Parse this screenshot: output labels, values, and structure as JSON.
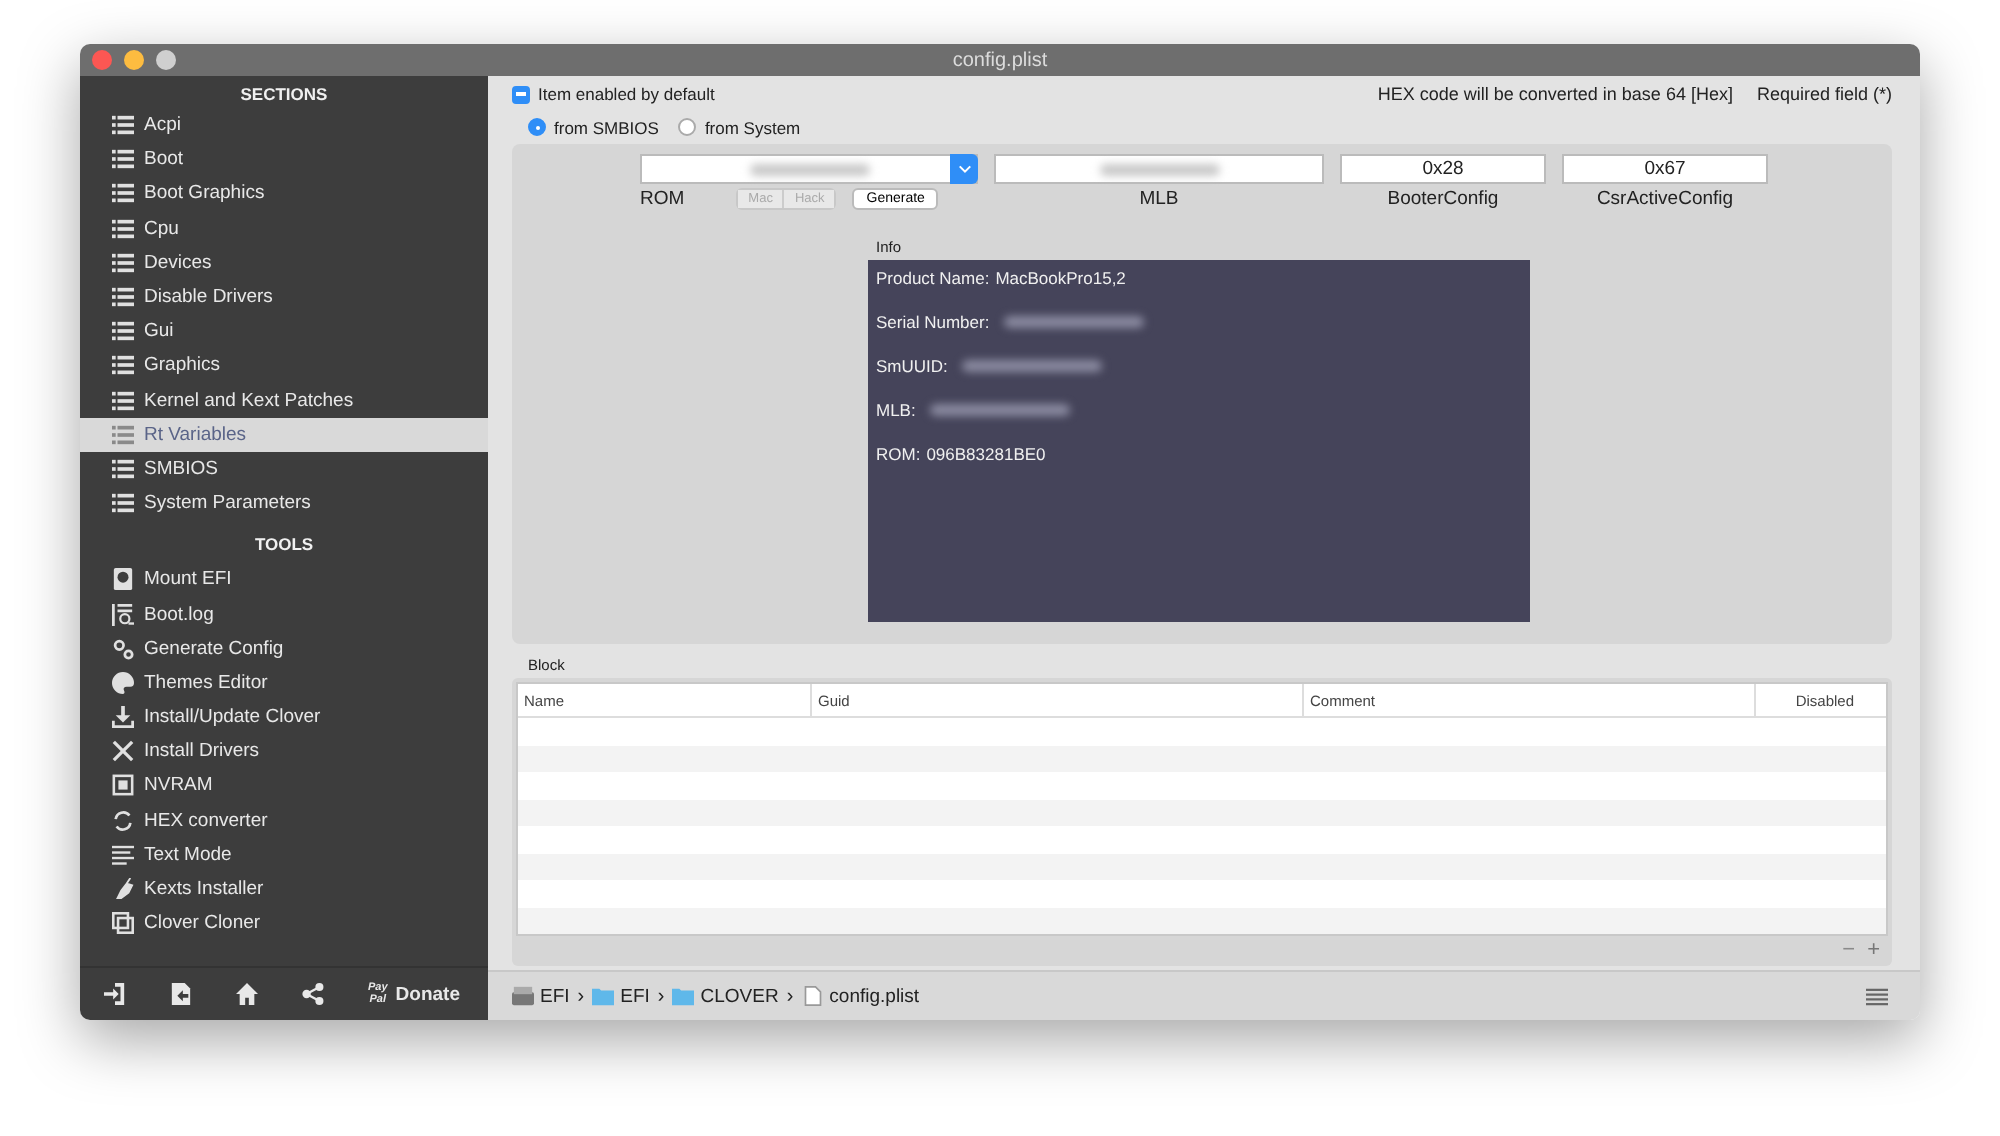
{
  "window": {
    "title": "config.plist"
  },
  "sidebar": {
    "sections_heading": "SECTIONS",
    "sections": [
      {
        "label": "Acpi",
        "selected": false
      },
      {
        "label": "Boot",
        "selected": false
      },
      {
        "label": "Boot Graphics",
        "selected": false
      },
      {
        "label": "Cpu",
        "selected": false
      },
      {
        "label": "Devices",
        "selected": false
      },
      {
        "label": "Disable Drivers",
        "selected": false
      },
      {
        "label": "Gui",
        "selected": false
      },
      {
        "label": "Graphics",
        "selected": false
      },
      {
        "label": "Kernel and Kext Patches",
        "selected": false
      },
      {
        "label": "Rt Variables",
        "selected": true
      },
      {
        "label": "SMBIOS",
        "selected": false
      },
      {
        "label": "System Parameters",
        "selected": false
      }
    ],
    "tools_heading": "TOOLS",
    "tools": [
      {
        "label": "Mount EFI"
      },
      {
        "label": "Boot.log"
      },
      {
        "label": "Generate Config"
      },
      {
        "label": "Themes Editor"
      },
      {
        "label": "Install/Update Clover"
      },
      {
        "label": "Install Drivers"
      },
      {
        "label": "NVRAM"
      },
      {
        "label": "HEX converter"
      },
      {
        "label": "Text Mode"
      },
      {
        "label": "Kexts Installer"
      },
      {
        "label": "Clover Cloner"
      }
    ],
    "donate": {
      "paypal_top": "Pay",
      "paypal_bottom": "Pal",
      "label": "Donate"
    }
  },
  "main": {
    "enabled_checkbox": {
      "label": "Item enabled by default",
      "checked": true
    },
    "hex_note": "HEX code will be converted in base 64 [Hex]",
    "required_note": "Required field (*)",
    "source_radios": [
      {
        "label": "from SMBIOS",
        "selected": true
      },
      {
        "label": "from System",
        "selected": false
      }
    ],
    "rom": {
      "label": "ROM",
      "redacted": true
    },
    "mac_hack": [
      {
        "label": "Mac",
        "disabled": true
      },
      {
        "label": "Hack",
        "disabled": true
      }
    ],
    "generate": "Generate",
    "mlb": {
      "label": "MLB",
      "redacted": true
    },
    "booter_config": {
      "label": "BooterConfig",
      "value": "0x28"
    },
    "csr_active_config": {
      "label": "CsrActiveConfig",
      "value": "0x67"
    },
    "info": {
      "label": "Info",
      "lines": [
        {
          "label": "Product Name:",
          "value": "MacBookPro15,2"
        },
        {
          "label": "Serial Number:"
        },
        {
          "label": "SmUUID:"
        },
        {
          "label": "MLB:"
        },
        {
          "label": "ROM:",
          "value": "096B83281BE0"
        }
      ]
    },
    "block": {
      "label": "Block",
      "columns": [
        "Name",
        "Guid",
        "Comment",
        "Disabled"
      ],
      "remove": "−",
      "add": "+"
    },
    "breadcrumb": [
      {
        "kind": "disk",
        "label": "EFI",
        "separator": "›"
      },
      {
        "kind": "folder",
        "label": "EFI",
        "separator": "›"
      },
      {
        "kind": "folder",
        "label": "CLOVER",
        "separator": "›"
      },
      {
        "kind": "file",
        "label": "config.plist"
      }
    ]
  }
}
